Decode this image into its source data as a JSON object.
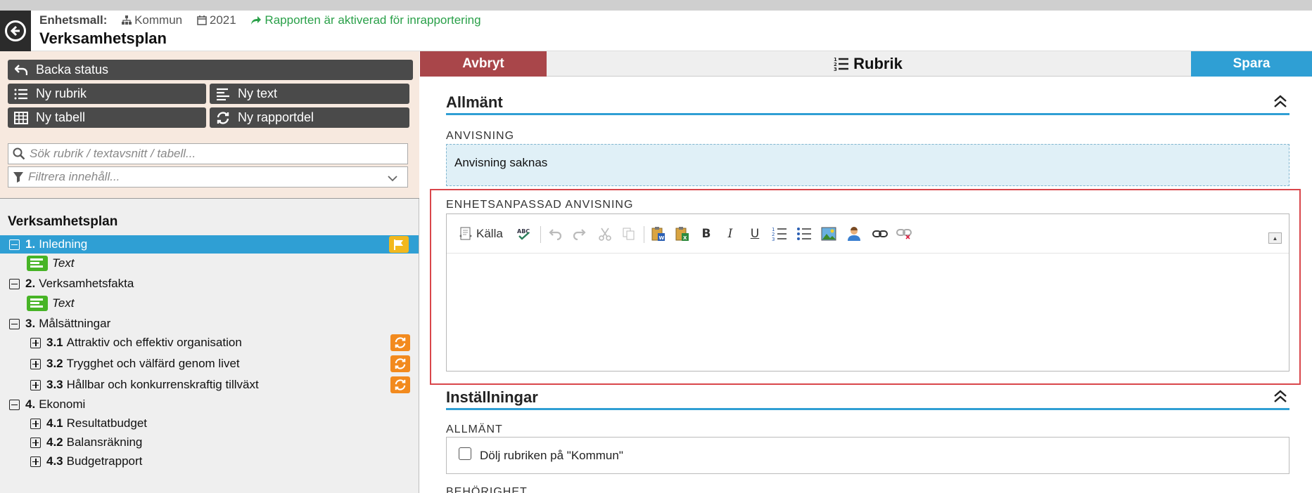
{
  "header": {
    "template_label": "Enhetsmall:",
    "org": "Kommun",
    "year": "2021",
    "status": "Rapporten är aktiverad för inrapportering",
    "title": "Verksamhetsplan"
  },
  "sidebar": {
    "buttons": {
      "back_status": "Backa status",
      "new_heading": "Ny rubrik",
      "new_text": "Ny text",
      "new_table": "Ny tabell",
      "new_report_part": "Ny rapportdel"
    },
    "search_placeholder": "Sök rubrik / textavsnitt / tabell...",
    "filter_placeholder": "Filtrera innehåll...",
    "tree_title": "Verksamhetsplan",
    "tree": [
      {
        "num": "1.",
        "label": "Inledning"
      },
      {
        "label": "Text"
      },
      {
        "num": "2.",
        "label": "Verksamhetsfakta"
      },
      {
        "label": "Text"
      },
      {
        "num": "3.",
        "label": "Målsättningar"
      },
      {
        "num": "3.1",
        "label": "Attraktiv och effektiv organisation"
      },
      {
        "num": "3.2",
        "label": "Trygghet och välfärd genom livet"
      },
      {
        "num": "3.3",
        "label": "Hållbar och konkurrenskraftig tillväxt"
      },
      {
        "num": "4.",
        "label": "Ekonomi"
      },
      {
        "num": "4.1",
        "label": "Resultatbudget"
      },
      {
        "num": "4.2",
        "label": "Balansräkning"
      },
      {
        "num": "4.3",
        "label": "Budgetrapport"
      }
    ]
  },
  "actions": {
    "cancel": "Avbryt",
    "heading": "Rubrik",
    "save": "Spara"
  },
  "general": {
    "title": "Allmänt",
    "instruction_label": "ANVISNING",
    "instruction_text": "Anvisning saknas",
    "unit_instruction_label": "ENHETSANPASSAD ANVISNING",
    "source_button": "Källa"
  },
  "settings": {
    "title": "Inställningar",
    "general_label": "ALLMÄNT",
    "hide_heading": "Dölj rubriken på \"Kommun\"",
    "permission_label": "BEHÖRIGHET"
  },
  "colors": {
    "accent": "#2f9fd4",
    "cancel": "#a9464a",
    "status_green": "#2aa049",
    "text_icon_green": "#47b426",
    "badge_orange": "#f28a1e",
    "badge_yellow": "#f2b81e"
  }
}
